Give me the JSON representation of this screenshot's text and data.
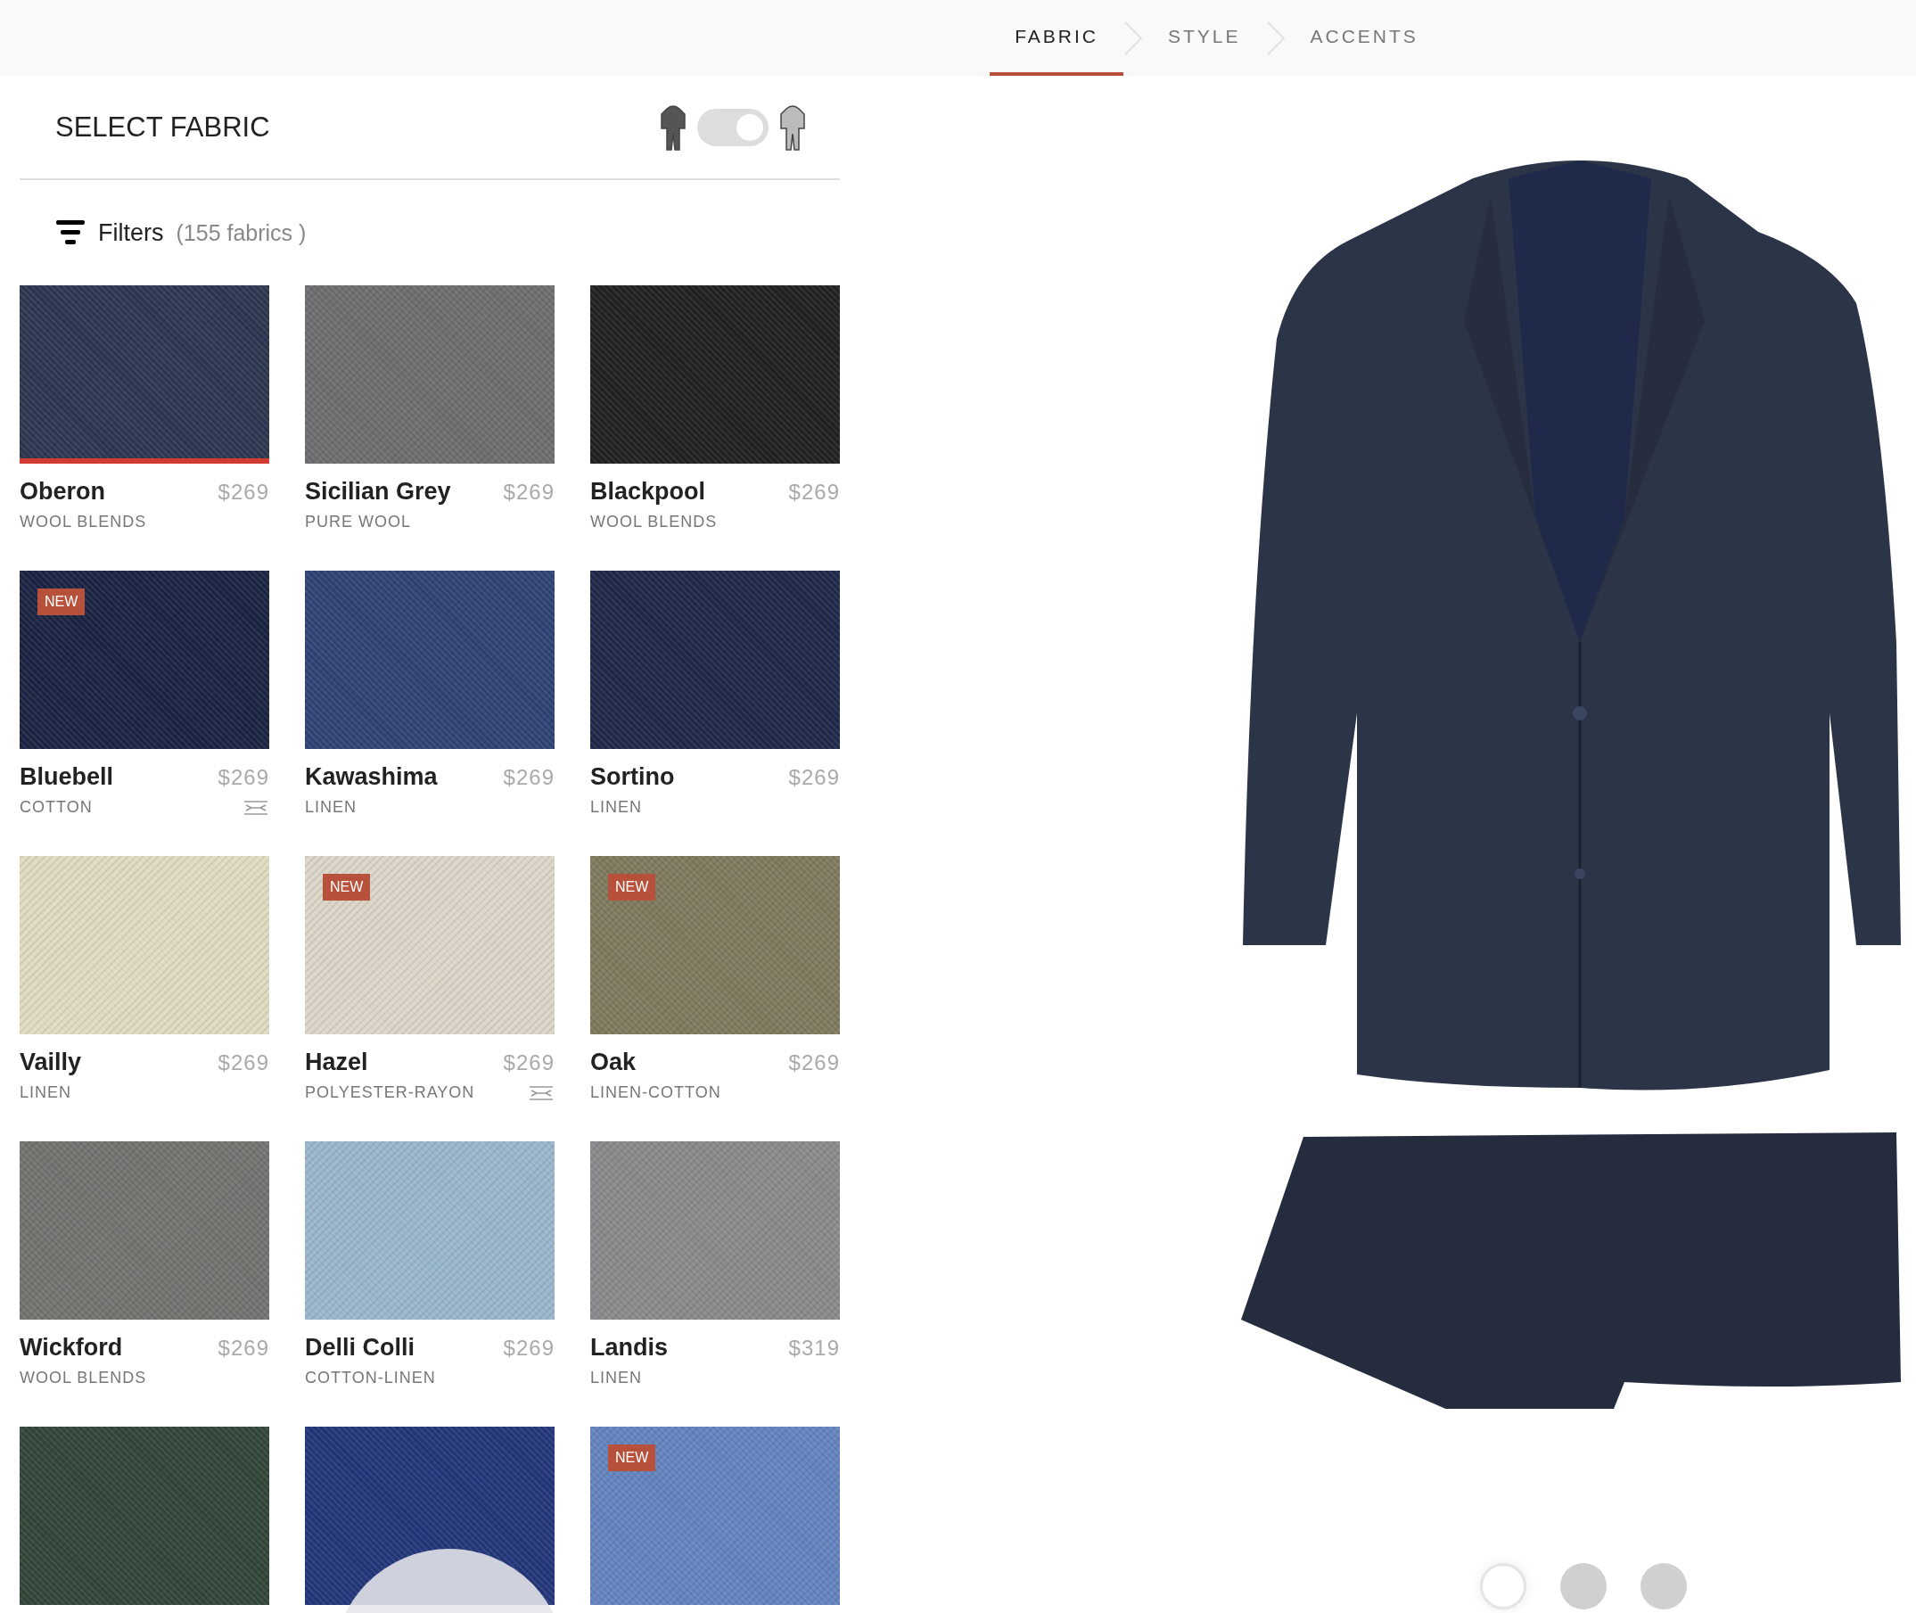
{
  "steps": [
    {
      "label": "FABRIC",
      "selected": true
    },
    {
      "label": "STYLE",
      "selected": false
    },
    {
      "label": "ACCENTS",
      "selected": false
    }
  ],
  "panel": {
    "title": "SELECT FABRIC",
    "toggle": {
      "on": true
    },
    "filters": {
      "label": "Filters",
      "count": "(155 fabrics )"
    }
  },
  "fabrics": [
    {
      "name": "Oberon",
      "price": "$269",
      "category": "WOOL BLENDS",
      "color": "#2d3850",
      "selected": true,
      "stretch": false
    },
    {
      "name": "Sicilian Grey",
      "price": "$269",
      "category": "PURE WOOL",
      "color": "#6e6e70",
      "selected": false,
      "stretch": false
    },
    {
      "name": "Blackpool",
      "price": "$269",
      "category": "WOOL BLENDS",
      "color": "#222222",
      "selected": false,
      "stretch": false
    },
    {
      "name": "Bluebell",
      "price": "$269",
      "category": "COTTON",
      "color": "#1b2442",
      "selected": false,
      "stretch": true,
      "badge": "NEW"
    },
    {
      "name": "Kawashima",
      "price": "$269",
      "category": "LINEN",
      "color": "#2f4474",
      "selected": false,
      "stretch": false
    },
    {
      "name": "Sortino",
      "price": "$269",
      "category": "LINEN",
      "color": "#1f2a4a",
      "selected": false,
      "stretch": false
    },
    {
      "name": "Vailly",
      "price": "$269",
      "category": "LINEN",
      "color": "#e0dbc0",
      "selected": false,
      "stretch": false
    },
    {
      "name": "Hazel",
      "price": "$269",
      "category": "POLYESTER-RAYON",
      "color": "#dcd6c8",
      "selected": false,
      "stretch": true,
      "badge": "NEW"
    },
    {
      "name": "Oak",
      "price": "$269",
      "category": "LINEN-COTTON",
      "color": "#7f7a5e",
      "selected": false,
      "stretch": false,
      "badge": "NEW"
    },
    {
      "name": "Wickford",
      "price": "$269",
      "category": "WOOL BLENDS",
      "color": "#737370",
      "selected": false,
      "stretch": false
    },
    {
      "name": "Delli Colli",
      "price": "$269",
      "category": "COTTON-LINEN",
      "color": "#9ab6cc",
      "selected": false,
      "stretch": false
    },
    {
      "name": "Landis",
      "price": "$319",
      "category": "LINEN",
      "color": "#8a8a8c",
      "selected": false,
      "stretch": false
    },
    {
      "color": "#33473a",
      "selected": false
    },
    {
      "color": "#24367a",
      "selected": false
    },
    {
      "color": "#6483bf",
      "selected": false,
      "badge": "NEW"
    }
  ],
  "views": [
    {
      "selected": true
    },
    {
      "selected": false
    },
    {
      "selected": false
    }
  ]
}
